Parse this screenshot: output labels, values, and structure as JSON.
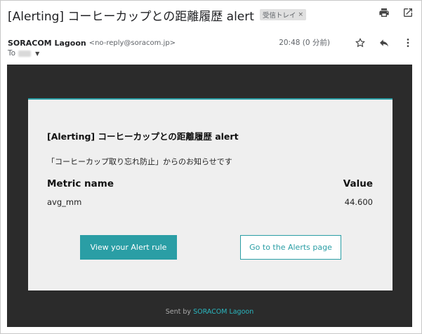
{
  "header": {
    "subject": "[Alerting] コーヒーカップとの距離履歴 alert",
    "label": "受信トレイ",
    "label_close": "×"
  },
  "sender": {
    "name": "SORACOM Lagoon",
    "email": "<no-reply@soracom.jp>",
    "timestamp": "20:48 (0 分前)",
    "to_label": "To"
  },
  "icons": {
    "print": "printer-icon",
    "open_new": "open-in-new-icon",
    "star": "star-icon",
    "reply": "reply-icon",
    "more": "more-vert-icon",
    "caret": "caret-down-icon"
  },
  "mail": {
    "title": "[Alerting] コーヒーカップとの距離履歴 alert",
    "intro": "「コーヒーカップ取り忘れ防止」からのお知らせです",
    "metric_header": "Metric name",
    "value_header": "Value",
    "rows": [
      {
        "metric": "avg_mm",
        "value": "44.600"
      }
    ],
    "primary_button": "View your Alert rule",
    "secondary_button": "Go to the Alerts page",
    "footer_prefix": "Sent by",
    "footer_brand": "SORACOM Lagoon"
  },
  "colors": {
    "accent": "#2a9ea5",
    "mail_background": "#2b2b2b",
    "card_background": "#efefef"
  }
}
